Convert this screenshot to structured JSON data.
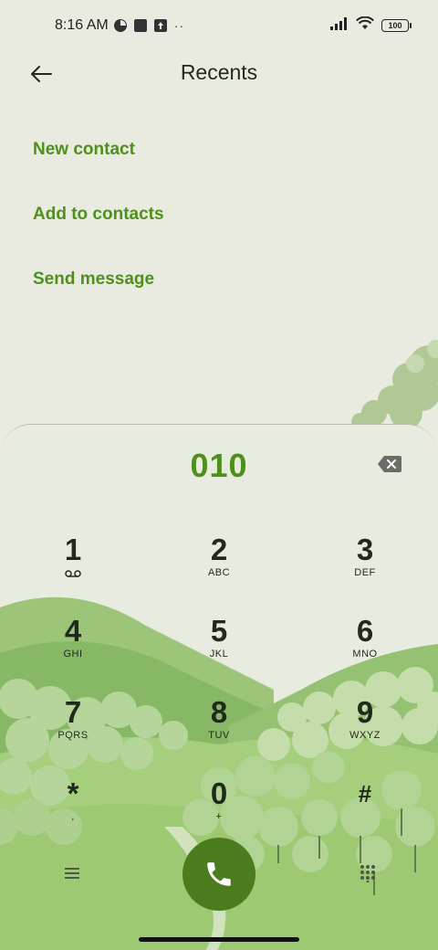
{
  "status_bar": {
    "time": "8:16 AM",
    "battery": "100"
  },
  "header": {
    "title": "Recents"
  },
  "menu": [
    {
      "label": "New contact"
    },
    {
      "label": "Add to contacts"
    },
    {
      "label": "Send message"
    }
  ],
  "dialpad": {
    "number": "010",
    "keys": [
      {
        "digit": "1",
        "letters": ""
      },
      {
        "digit": "2",
        "letters": "ABC"
      },
      {
        "digit": "3",
        "letters": "DEF"
      },
      {
        "digit": "4",
        "letters": "GHI"
      },
      {
        "digit": "5",
        "letters": "JKL"
      },
      {
        "digit": "6",
        "letters": "MNO"
      },
      {
        "digit": "7",
        "letters": "PQRS"
      },
      {
        "digit": "8",
        "letters": "TUV"
      },
      {
        "digit": "9",
        "letters": "WXYZ"
      },
      {
        "digit": "*",
        "letters": ","
      },
      {
        "digit": "0",
        "letters": "+"
      },
      {
        "digit": "#",
        "letters": ""
      }
    ]
  },
  "icons": {
    "back": "arrow-left-icon",
    "backspace": "backspace-icon",
    "voicemail": "voicemail-icon",
    "call": "phone-icon",
    "menu": "menu-lines-icon",
    "dialpad_toggle": "dialpad-grid-icon"
  },
  "colors": {
    "accent": "#4f8f1b",
    "call_button": "#4b7c1d",
    "background": "#e9ebe0"
  }
}
